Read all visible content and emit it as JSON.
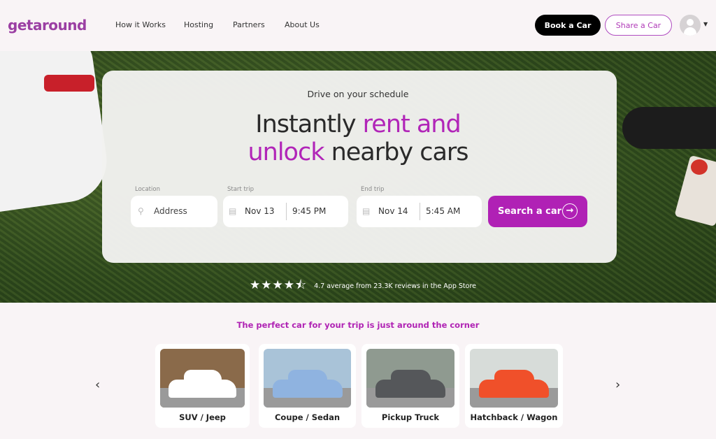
{
  "header": {
    "logo": "getaround",
    "nav": [
      "How it Works",
      "Hosting",
      "Partners",
      "About Us"
    ],
    "book_label": "Book a Car",
    "share_label": "Share a Car"
  },
  "hero": {
    "kicker": "Drive on your schedule",
    "headline_1a": "Instantly ",
    "headline_1b": "rent and",
    "headline_2a": "unlock",
    "headline_2b": " nearby cars",
    "location_label": "Location",
    "location_placeholder": "Address",
    "start_label": "Start trip",
    "start_date": "Nov 13",
    "start_time": "9:45 PM",
    "end_label": "End trip",
    "end_date": "Nov 14",
    "end_time": "5:45 AM",
    "search_label": "Search a car",
    "rating_stars": 4.7,
    "rating_text": "4.7 average from 23.3K reviews in the App Store"
  },
  "categories": {
    "tagline": "The perfect car for your trip is just around the corner",
    "items": [
      {
        "label": "SUV / Jeep",
        "color": "#ffffff"
      },
      {
        "label": "Coupe / Sedan",
        "color": "#8fb3e0"
      },
      {
        "label": "Pickup Truck",
        "color": "#55575a"
      },
      {
        "label": "Hatchback / Wagon",
        "color": "#f0502a"
      }
    ]
  },
  "colors": {
    "accent": "#b021b5",
    "logo": "#9b3fa3"
  }
}
